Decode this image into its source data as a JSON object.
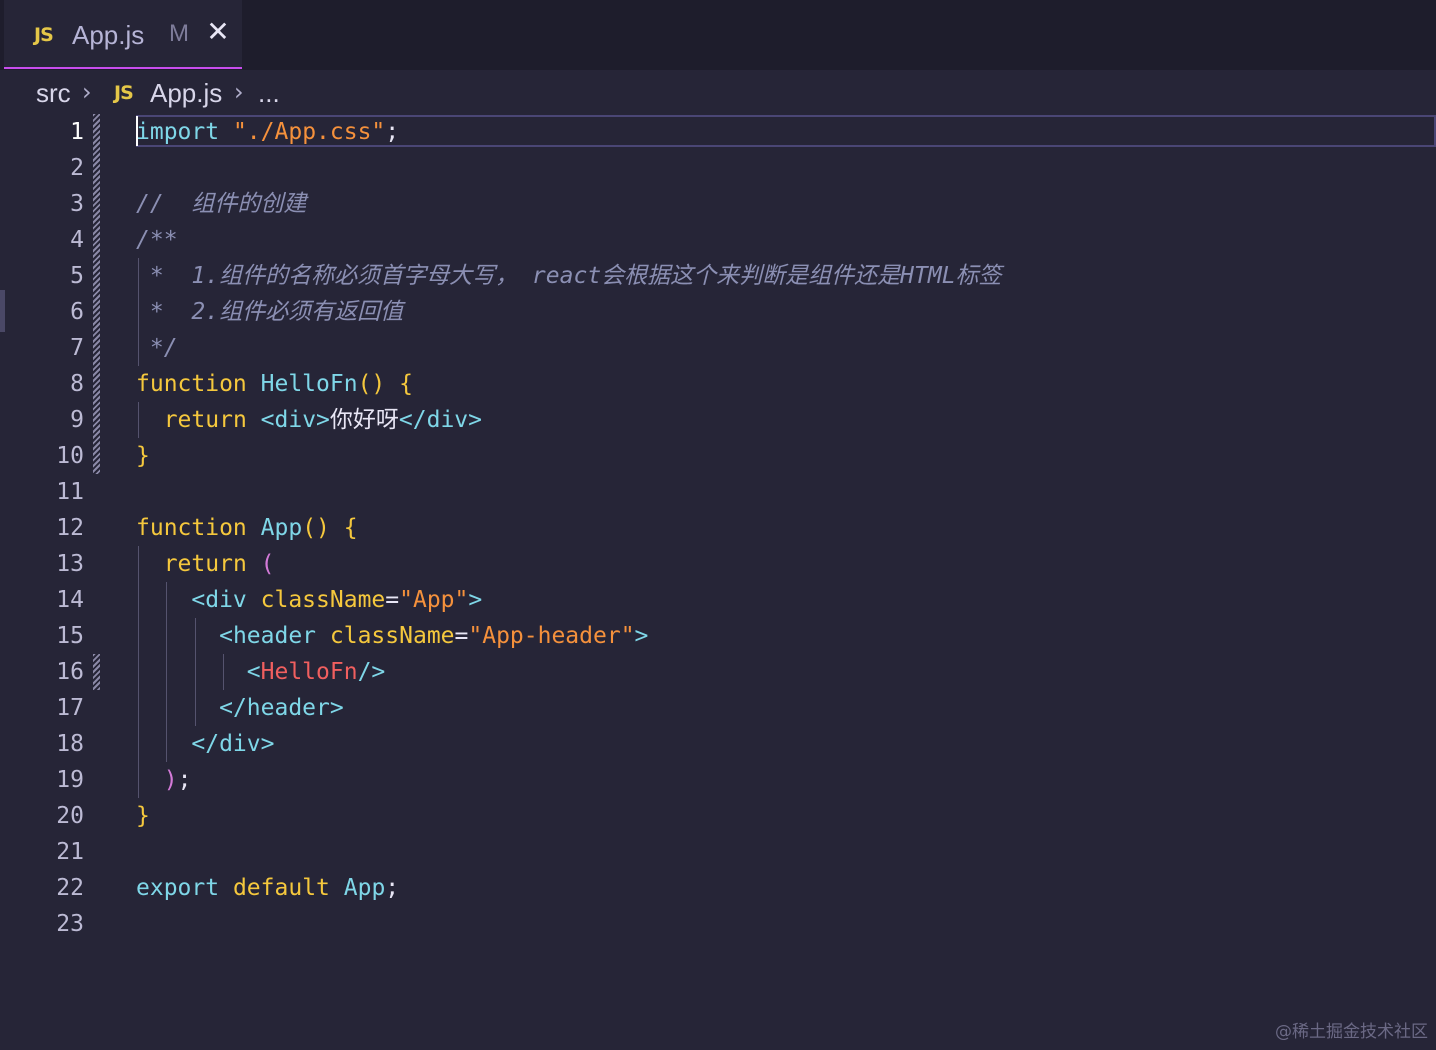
{
  "tab": {
    "icon": "JS",
    "label": "App.js",
    "modified": "M",
    "close": "✕"
  },
  "breadcrumb": {
    "folder": "src",
    "icon": "JS",
    "file": "App.js",
    "more": "..."
  },
  "editor": {
    "active_line": 1,
    "line_numbers": [
      "1",
      "2",
      "3",
      "4",
      "5",
      "6",
      "7",
      "8",
      "9",
      "10",
      "11",
      "12",
      "13",
      "14",
      "15",
      "16",
      "17",
      "18",
      "19",
      "20",
      "21",
      "22",
      "23"
    ],
    "lines": [
      [
        {
          "t": "kw-b",
          "v": "import"
        },
        {
          "t": "plain",
          "v": " "
        },
        {
          "t": "str",
          "v": "\"./App.css\""
        },
        {
          "t": "plain",
          "v": ";"
        }
      ],
      [],
      [
        {
          "t": "cmt",
          "v": "//  组件的创建"
        }
      ],
      [
        {
          "t": "cmt",
          "v": "/**"
        }
      ],
      [
        {
          "t": "cmt",
          "v": " *  1.组件的名称必须首字母大写， react会根据这个来判断是组件还是HTML标签"
        }
      ],
      [
        {
          "t": "cmt",
          "v": " *  2.组件必须有返回值"
        }
      ],
      [
        {
          "t": "cmt",
          "v": " */"
        }
      ],
      [
        {
          "t": "kw",
          "v": "function"
        },
        {
          "t": "plain",
          "v": " "
        },
        {
          "t": "fn",
          "v": "HelloFn"
        },
        {
          "t": "br-y",
          "v": "()"
        },
        {
          "t": "plain",
          "v": " "
        },
        {
          "t": "br-y",
          "v": "{"
        }
      ],
      [
        {
          "t": "plain",
          "v": "  "
        },
        {
          "t": "kw",
          "v": "return"
        },
        {
          "t": "plain",
          "v": " "
        },
        {
          "t": "tag",
          "v": "<div>"
        },
        {
          "t": "plain",
          "v": "你好呀"
        },
        {
          "t": "tag",
          "v": "</div>"
        }
      ],
      [
        {
          "t": "br-y",
          "v": "}"
        }
      ],
      [],
      [
        {
          "t": "kw",
          "v": "function"
        },
        {
          "t": "plain",
          "v": " "
        },
        {
          "t": "fn",
          "v": "App"
        },
        {
          "t": "br-y",
          "v": "()"
        },
        {
          "t": "plain",
          "v": " "
        },
        {
          "t": "br-y",
          "v": "{"
        }
      ],
      [
        {
          "t": "plain",
          "v": "  "
        },
        {
          "t": "kw",
          "v": "return"
        },
        {
          "t": "plain",
          "v": " "
        },
        {
          "t": "br-p",
          "v": "("
        }
      ],
      [
        {
          "t": "plain",
          "v": "    "
        },
        {
          "t": "tag",
          "v": "<div"
        },
        {
          "t": "plain",
          "v": " "
        },
        {
          "t": "attr",
          "v": "className"
        },
        {
          "t": "plain",
          "v": "="
        },
        {
          "t": "str",
          "v": "\"App\""
        },
        {
          "t": "tag",
          "v": ">"
        }
      ],
      [
        {
          "t": "plain",
          "v": "      "
        },
        {
          "t": "tag",
          "v": "<header"
        },
        {
          "t": "plain",
          "v": " "
        },
        {
          "t": "attr",
          "v": "className"
        },
        {
          "t": "plain",
          "v": "="
        },
        {
          "t": "str",
          "v": "\"App-header\""
        },
        {
          "t": "tag",
          "v": ">"
        }
      ],
      [
        {
          "t": "plain",
          "v": "        "
        },
        {
          "t": "tag",
          "v": "<"
        },
        {
          "t": "tagred",
          "v": "HelloFn"
        },
        {
          "t": "tag",
          "v": "/>"
        }
      ],
      [
        {
          "t": "plain",
          "v": "      "
        },
        {
          "t": "tag",
          "v": "</header>"
        }
      ],
      [
        {
          "t": "plain",
          "v": "    "
        },
        {
          "t": "tag",
          "v": "</div>"
        }
      ],
      [
        {
          "t": "plain",
          "v": "  "
        },
        {
          "t": "br-p",
          "v": ")"
        },
        {
          "t": "plain",
          "v": ";"
        }
      ],
      [
        {
          "t": "br-y",
          "v": "}"
        }
      ],
      [],
      [
        {
          "t": "kw-b",
          "v": "export"
        },
        {
          "t": "plain",
          "v": " "
        },
        {
          "t": "kw",
          "v": "default"
        },
        {
          "t": "plain",
          "v": " "
        },
        {
          "t": "fn",
          "v": "App"
        },
        {
          "t": "plain",
          "v": ";"
        }
      ],
      []
    ]
  },
  "watermark": "@稀土掘金技术社区",
  "colors": {
    "background": "#262537",
    "tab_accent": "#c74ded",
    "keyword": "#f5c83d",
    "string": "#f5913c",
    "tag": "#7fd7e8",
    "comment": "#8b8fb3"
  }
}
